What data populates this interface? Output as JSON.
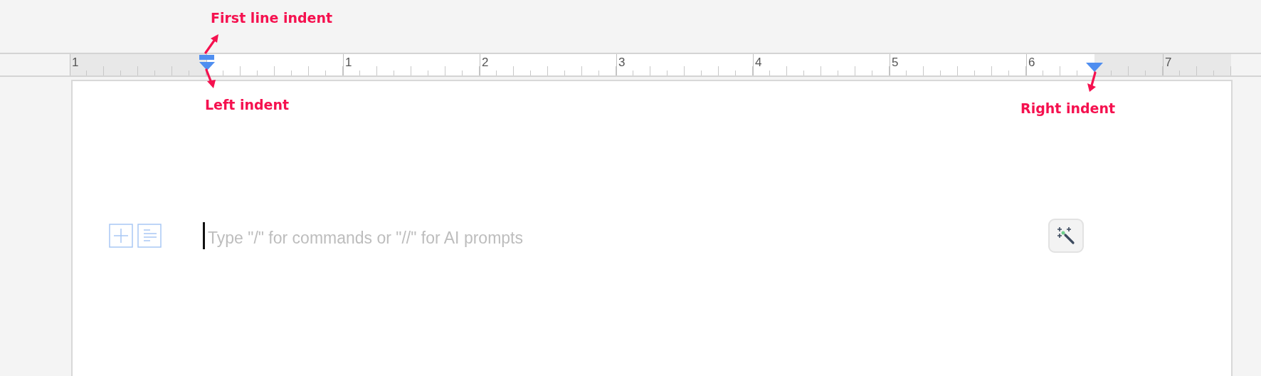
{
  "annotations": [
    {
      "kind": "first_line",
      "text": "First line indent"
    },
    {
      "kind": "left",
      "text": "Left indent"
    },
    {
      "kind": "right",
      "text": "Right indent"
    }
  ],
  "ruler": {
    "labels": [
      "1",
      "1",
      "2",
      "3",
      "4",
      "5",
      "6",
      "7"
    ]
  },
  "editor": {
    "placeholder": "Type \"/\" for commands or \"//\" for AI prompts"
  }
}
